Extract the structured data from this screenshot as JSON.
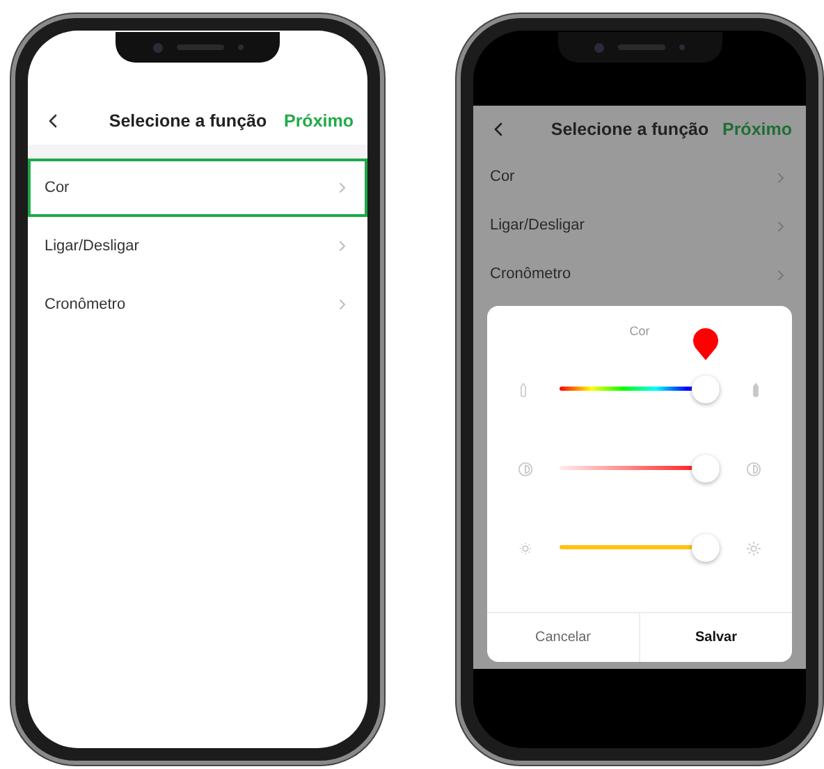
{
  "left_phone": {
    "header": {
      "title": "Selecione a função",
      "action": "Próximo"
    },
    "items": [
      {
        "label": "Cor",
        "selected": true
      },
      {
        "label": "Ligar/Desligar",
        "selected": false
      },
      {
        "label": "Cronômetro",
        "selected": false
      }
    ]
  },
  "right_phone": {
    "header": {
      "title": "Selecione a função",
      "action": "Próximo"
    },
    "items": [
      {
        "label": "Cor",
        "selected": false
      },
      {
        "label": "Ligar/Desligar",
        "selected": false
      },
      {
        "label": "Cronômetro",
        "selected": false
      }
    ],
    "dialog": {
      "title": "Cor",
      "sliders": [
        {
          "kind": "hue",
          "level": 1
        },
        {
          "kind": "saturation",
          "level": 1
        },
        {
          "kind": "brightness",
          "level": 1
        }
      ],
      "buttons": [
        {
          "label": "Cancelar",
          "primary": false
        },
        {
          "label": "Salvar",
          "primary": true
        }
      ]
    }
  }
}
